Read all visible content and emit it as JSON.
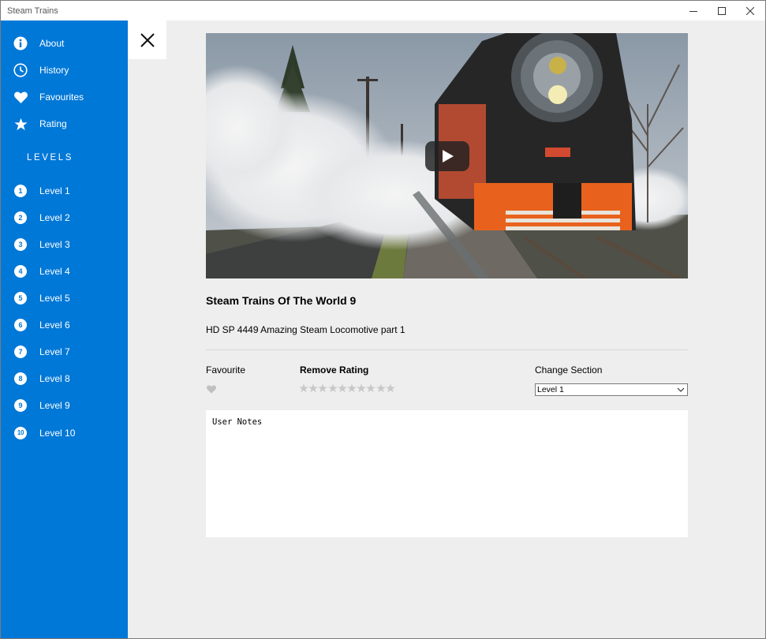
{
  "window": {
    "title": "Steam Trains"
  },
  "sidebar": {
    "items": [
      {
        "label": "About",
        "icon": "info-icon"
      },
      {
        "label": "History",
        "icon": "clock-icon"
      },
      {
        "label": "Favourites",
        "icon": "heart-icon"
      },
      {
        "label": "Rating",
        "icon": "star-icon"
      }
    ],
    "levels_heading": "LEVELS",
    "levels": [
      {
        "num": "1",
        "label": "Level 1"
      },
      {
        "num": "2",
        "label": "Level 2"
      },
      {
        "num": "3",
        "label": "Level 3"
      },
      {
        "num": "4",
        "label": "Level 4"
      },
      {
        "num": "5",
        "label": "Level 5"
      },
      {
        "num": "6",
        "label": "Level 6"
      },
      {
        "num": "7",
        "label": "Level 7"
      },
      {
        "num": "8",
        "label": "Level 8"
      },
      {
        "num": "9",
        "label": "Level 9"
      },
      {
        "num": "10",
        "label": "Level 10"
      }
    ]
  },
  "detail": {
    "title": "Steam Trains Of The World 9",
    "description": "HD SP 4449 Amazing Steam Locomotive part 1",
    "favourite_label": "Favourite",
    "rating_label": "Remove Rating",
    "rating_value": 0,
    "rating_max": 10,
    "section_label": "Change Section",
    "section_value": "Level 1",
    "notes_placeholder": "User Notes"
  },
  "colors": {
    "accent": "#0078d7",
    "star_inactive": "#c8c8c8",
    "heart_inactive": "#c0c0c0"
  }
}
